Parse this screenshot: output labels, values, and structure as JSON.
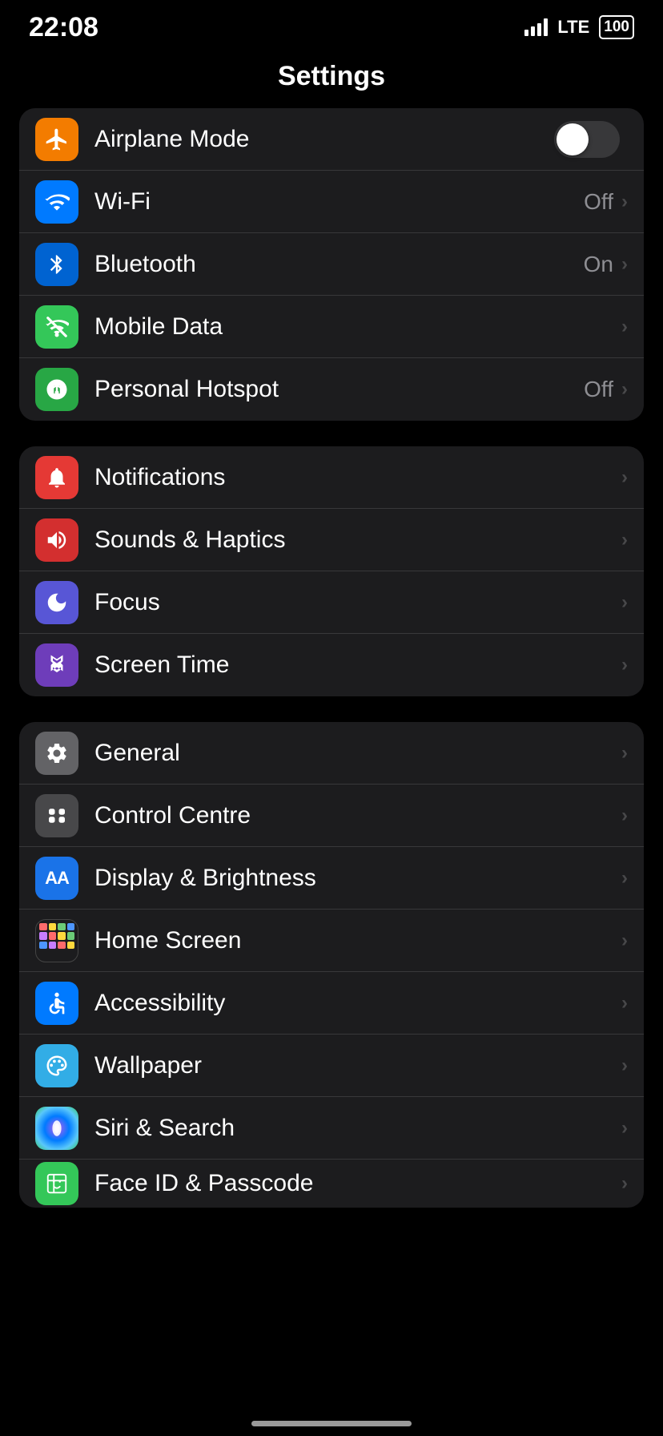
{
  "statusBar": {
    "time": "22:08",
    "lte": "LTE",
    "battery": "100"
  },
  "pageTitle": "Settings",
  "groups": [
    {
      "id": "connectivity",
      "rows": [
        {
          "id": "airplane-mode",
          "label": "Airplane Mode",
          "icon": "✈",
          "iconClass": "icon-orange",
          "value": "",
          "hasToggle": true,
          "toggleOn": false
        },
        {
          "id": "wifi",
          "label": "Wi-Fi",
          "icon": "wifi",
          "iconClass": "icon-blue",
          "value": "Off",
          "hasChevron": true
        },
        {
          "id": "bluetooth",
          "label": "Bluetooth",
          "icon": "bluetooth",
          "iconClass": "icon-blue-dark",
          "value": "On",
          "hasChevron": true
        },
        {
          "id": "mobile-data",
          "label": "Mobile Data",
          "icon": "mobile",
          "iconClass": "icon-green",
          "value": "",
          "hasChevron": true
        },
        {
          "id": "personal-hotspot",
          "label": "Personal Hotspot",
          "icon": "hotspot",
          "iconClass": "icon-green2",
          "value": "Off",
          "hasChevron": true
        }
      ]
    },
    {
      "id": "notifications",
      "rows": [
        {
          "id": "notifications",
          "label": "Notifications",
          "icon": "bell",
          "iconClass": "icon-red",
          "value": "",
          "hasChevron": true
        },
        {
          "id": "sounds-haptics",
          "label": "Sounds & Haptics",
          "icon": "sound",
          "iconClass": "icon-red2",
          "value": "",
          "hasChevron": true
        },
        {
          "id": "focus",
          "label": "Focus",
          "icon": "moon",
          "iconClass": "icon-purple",
          "value": "",
          "hasChevron": true
        },
        {
          "id": "screen-time",
          "label": "Screen Time",
          "icon": "hourglass",
          "iconClass": "icon-purple2",
          "value": "",
          "hasChevron": true
        }
      ]
    },
    {
      "id": "general",
      "rows": [
        {
          "id": "general",
          "label": "General",
          "icon": "gear",
          "iconClass": "icon-gray",
          "value": "",
          "hasChevron": true
        },
        {
          "id": "control-centre",
          "label": "Control Centre",
          "icon": "sliders",
          "iconClass": "icon-gray2",
          "value": "",
          "hasChevron": true
        },
        {
          "id": "display-brightness",
          "label": "Display & Brightness",
          "icon": "AA",
          "iconClass": "icon-aa-blue",
          "value": "",
          "hasChevron": true
        },
        {
          "id": "home-screen",
          "label": "Home Screen",
          "icon": "home-grid",
          "iconClass": "icon-multicolor",
          "value": "",
          "hasChevron": true
        },
        {
          "id": "accessibility",
          "label": "Accessibility",
          "icon": "person",
          "iconClass": "icon-blue",
          "value": "",
          "hasChevron": true
        },
        {
          "id": "wallpaper",
          "label": "Wallpaper",
          "icon": "flower",
          "iconClass": "icon-light-blue",
          "value": "",
          "hasChevron": true
        },
        {
          "id": "siri-search",
          "label": "Siri & Search",
          "icon": "siri",
          "iconClass": "siri-icon",
          "value": "",
          "hasChevron": true
        },
        {
          "id": "face-id",
          "label": "Face ID & Passcode",
          "icon": "faceid",
          "iconClass": "icon-green",
          "value": "",
          "hasChevron": true,
          "partial": true
        }
      ]
    }
  ]
}
